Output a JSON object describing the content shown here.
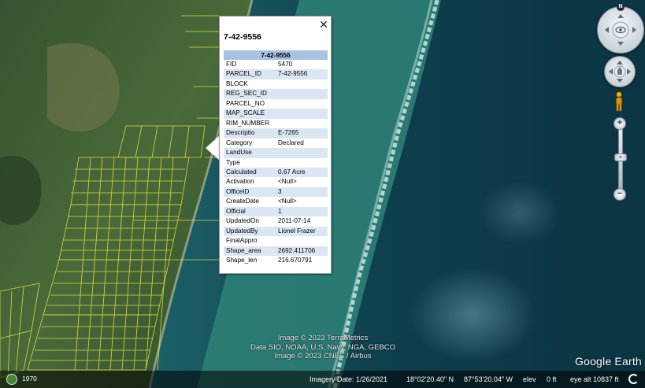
{
  "popup": {
    "title": "7-42-9556",
    "table_header": "7-42-9556",
    "close_symbol": "✕",
    "rows": [
      {
        "key": "FID",
        "value": "5470"
      },
      {
        "key": "PARCEL_ID",
        "value": "7-42-9556"
      },
      {
        "key": "BLOCK",
        "value": ""
      },
      {
        "key": "REG_SEC_ID",
        "value": ""
      },
      {
        "key": "PARCEL_NO",
        "value": ""
      },
      {
        "key": "MAP_SCALE",
        "value": ""
      },
      {
        "key": "RIM_NUMBER",
        "value": ""
      },
      {
        "key": "Descriptio",
        "value": "E-7265"
      },
      {
        "key": "Category",
        "value": "Declared"
      },
      {
        "key": "LandUse",
        "value": ""
      },
      {
        "key": "Type",
        "value": ""
      },
      {
        "key": "Calculated",
        "value": "0.67 Acre"
      },
      {
        "key": "Activation",
        "value": "<Null>"
      },
      {
        "key": "OfficeID",
        "value": "3"
      },
      {
        "key": "CreateDate",
        "value": "<Null>"
      },
      {
        "key": "Official",
        "value": "1"
      },
      {
        "key": "UpdatedOn",
        "value": "2011-07-14"
      },
      {
        "key": "UpdatedBy",
        "value": "Lionel Frazer"
      },
      {
        "key": "FinalAppro",
        "value": ""
      },
      {
        "key": "Shape_area",
        "value": "2692.411706"
      },
      {
        "key": "Shape_len",
        "value": "216.670791"
      }
    ]
  },
  "navigation": {
    "compass_letter": "N",
    "zoom_in": "+",
    "zoom_out": "−",
    "zoom_thumb": "="
  },
  "attribution": {
    "line1": "Image © 2023 TerraMetrics",
    "line2": "Data SIO, NOAA, U.S. Navy, NGA, GEBCO",
    "line3": "Image © 2023 CNES / Airbus"
  },
  "logo": "Google Earth",
  "statusbar": {
    "year": "1970",
    "imagery_date": "Imagery Date: 1/26/2021",
    "lat": "18°02'20.40\" N",
    "lon": "87°53'20.04\" W",
    "elev_label": "elev",
    "elev_value": "0 ft",
    "eye_alt": "eye alt  10837 ft"
  },
  "colors": {
    "parcel_lines": "#e8e83a",
    "table_header": "#a9c1e3",
    "table_alt_row": "#dbe6f4",
    "land": "#3f5a2f",
    "reef": "#3f8f88",
    "ocean": "#0f3a48"
  }
}
